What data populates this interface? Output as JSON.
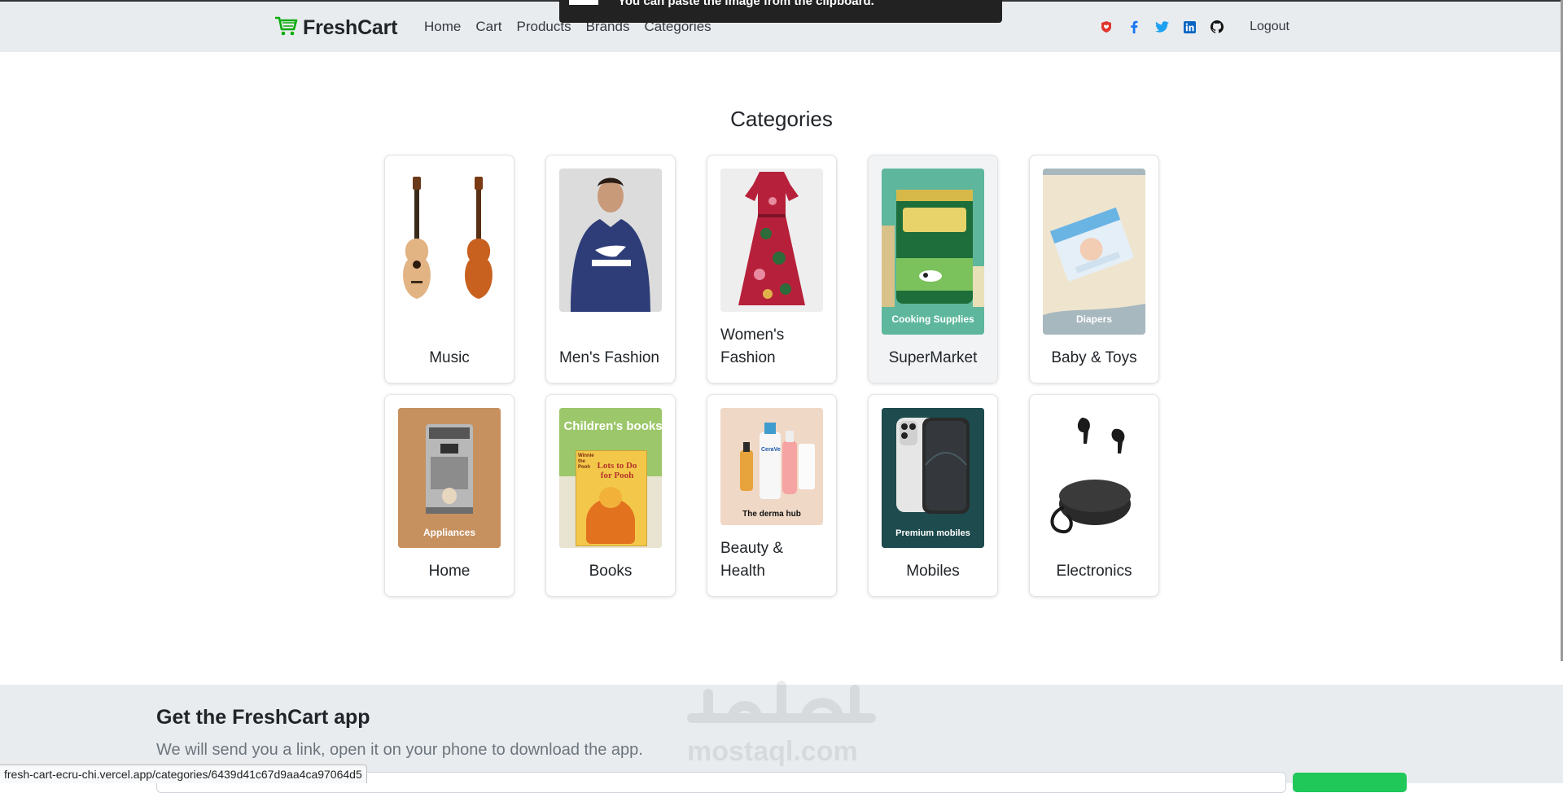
{
  "toast": {
    "message": "You can paste the image from the clipboard."
  },
  "navbar": {
    "brand": "FreshCart",
    "links": [
      "Home",
      "Cart",
      "Products",
      "Brands",
      "Categories"
    ],
    "logout": "Logout",
    "social_icons": [
      "shield-icon",
      "facebook-icon",
      "twitter-icon",
      "linkedin-icon",
      "github-icon"
    ],
    "brand_color": "#0aad0a"
  },
  "page": {
    "title": "Categories",
    "categories": [
      {
        "name": "Music",
        "image": "guitar-image"
      },
      {
        "name": "Men's Fashion",
        "image": "mens-hoodie-image"
      },
      {
        "name": "Women's Fashion",
        "image": "dress-image"
      },
      {
        "name": "SuperMarket",
        "image": "milk-powder-image",
        "caption": "Cooking Supplies"
      },
      {
        "name": "Baby & Toys",
        "image": "diapers-image",
        "caption": "Diapers"
      },
      {
        "name": "Home",
        "image": "coffee-machine-image",
        "caption": "Appliances"
      },
      {
        "name": "Books",
        "image": "childrens-book-image",
        "caption": "Children's books",
        "book_title": "Lots to Do for Pooh",
        "book_series": "Winnie the Pooh"
      },
      {
        "name": "Beauty & Health",
        "image": "cosmetics-image",
        "caption": "The derma hub",
        "product_brand": "CeraVe"
      },
      {
        "name": "Mobiles",
        "image": "iphone-image",
        "caption": "Premium mobiles"
      },
      {
        "name": "Electronics",
        "image": "earbuds-image"
      }
    ]
  },
  "footer": {
    "title": "Get the FreshCart app",
    "subtitle": "We will send you a link, open it on your phone to download the app.",
    "watermark": "mostaql.com"
  },
  "status_bar": {
    "url": "fresh-cart-ecru-chi.vercel.app/categories/6439d41c67d9aa4ca97064d5"
  }
}
